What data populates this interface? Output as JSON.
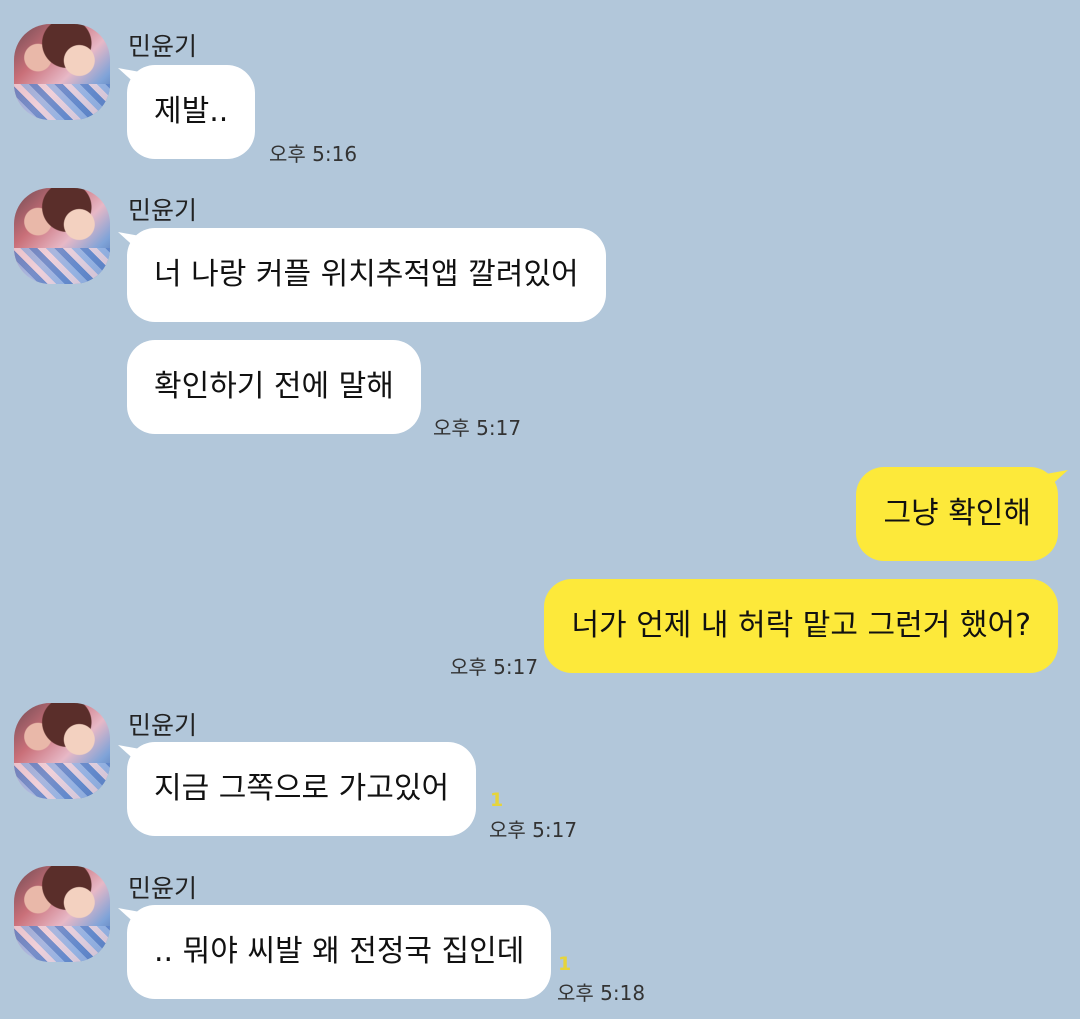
{
  "sender_name": "민윤기",
  "messages": [
    {
      "text": "제발..",
      "time": "오후 5:16"
    },
    {
      "text": "너 나랑 커플 위치추적앱 깔려있어"
    },
    {
      "text": "확인하기 전에 말해",
      "time": "오후 5:17"
    },
    {
      "text": "그냥 확인해"
    },
    {
      "text": "너가 언제 내 허락 맡고 그런거 했어?",
      "time": "오후 5:17"
    },
    {
      "text": "지금 그쪽으로 가고있어",
      "time": "오후 5:17",
      "unread": "1"
    },
    {
      "text": ".. 뭐야 씨발 왜 전정국 집인데",
      "time": "오후 5:18",
      "unread": "1"
    }
  ],
  "colors": {
    "background": "#b2c7da",
    "incoming": "#ffffff",
    "outgoing": "#fde93a"
  }
}
